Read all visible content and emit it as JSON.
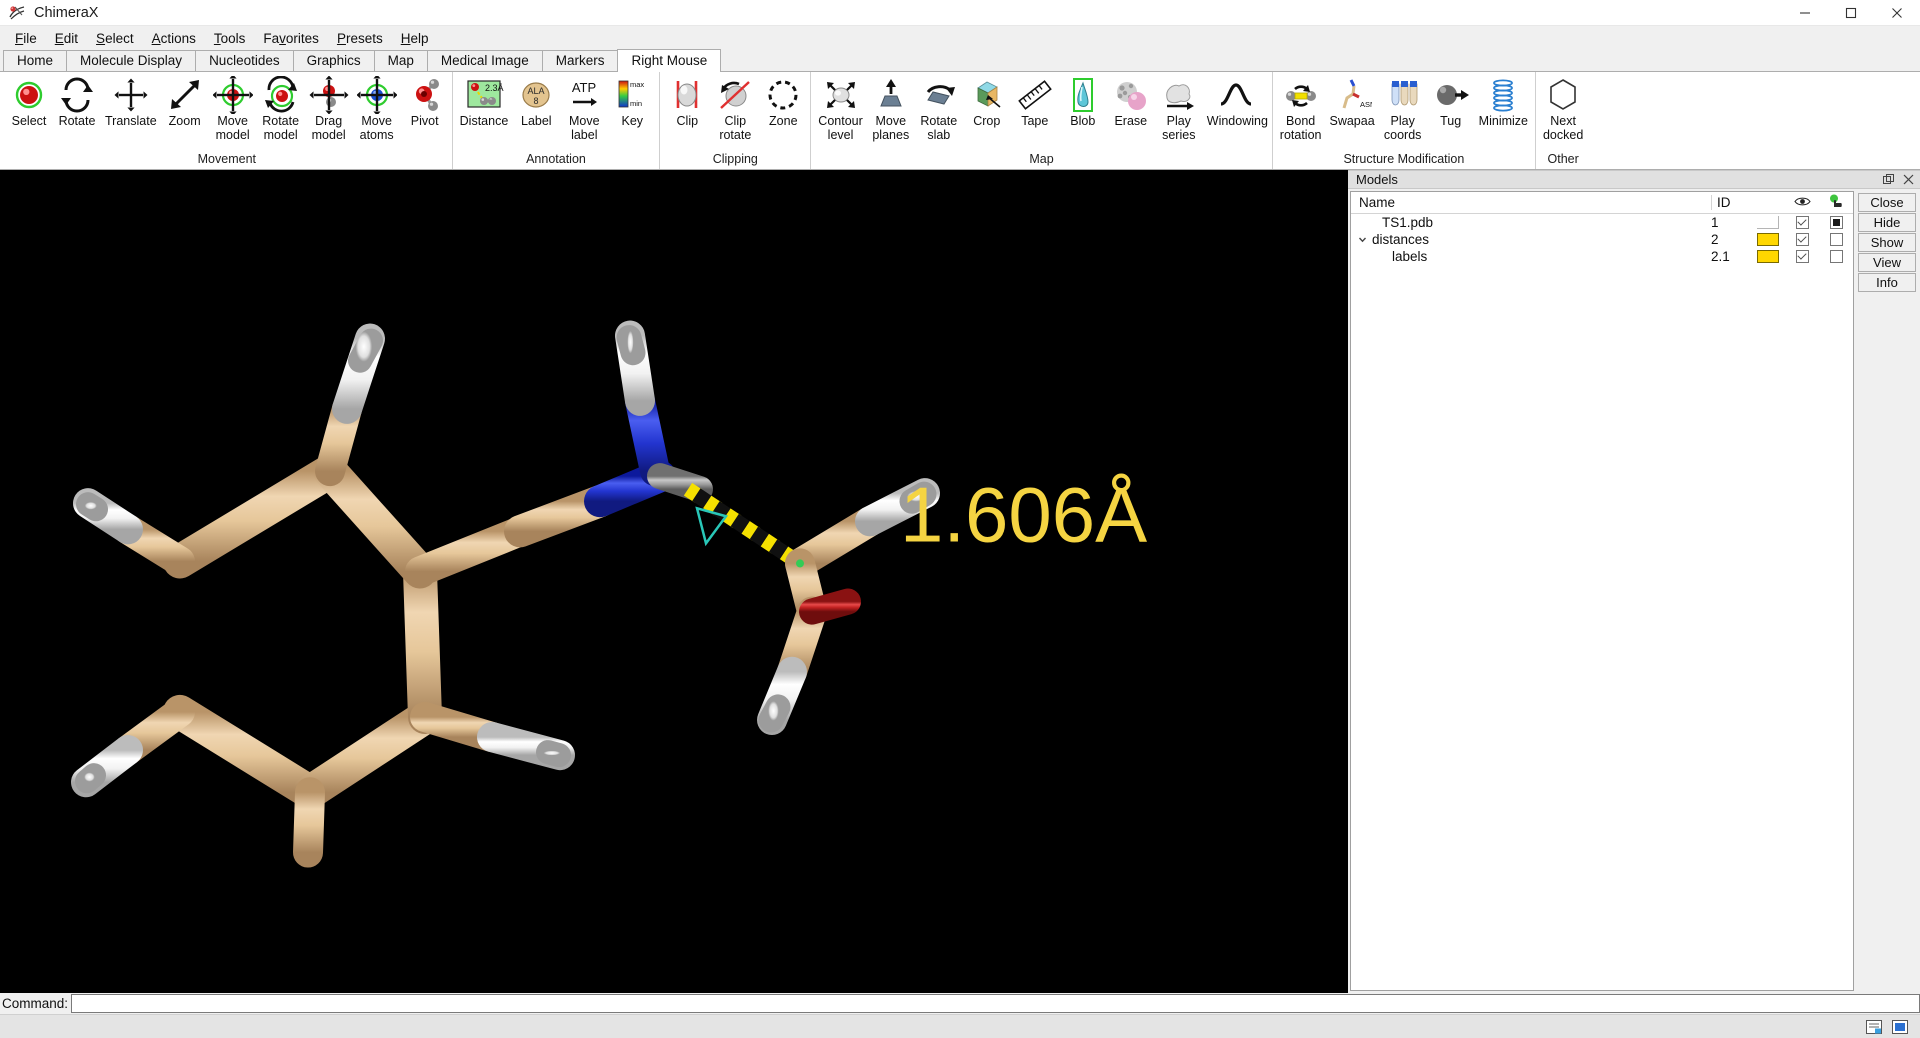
{
  "window": {
    "title": "ChimeraX",
    "app_icon": "chimerax-logo-icon",
    "minimize": "minimize-icon",
    "maximize": "maximize-icon",
    "close": "close-icon"
  },
  "menubar": {
    "items": [
      {
        "label": "File",
        "accel": "F"
      },
      {
        "label": "Edit",
        "accel": "E"
      },
      {
        "label": "Select",
        "accel": "S"
      },
      {
        "label": "Actions",
        "accel": "A"
      },
      {
        "label": "Tools",
        "accel": "T"
      },
      {
        "label": "Favorites",
        "accel": "v"
      },
      {
        "label": "Presets",
        "accel": "P"
      },
      {
        "label": "Help",
        "accel": "H"
      }
    ]
  },
  "tabs": {
    "active": "Right Mouse",
    "items": [
      "Home",
      "Molecule Display",
      "Nucleotides",
      "Graphics",
      "Map",
      "Medical Image",
      "Markers",
      "Right Mouse"
    ]
  },
  "ribbon": {
    "groups": [
      {
        "caption": "Movement",
        "buttons": [
          {
            "label": "Select",
            "icon": "red-sphere-select-icon"
          },
          {
            "label": "Rotate",
            "icon": "circular-arrows-rotate-icon"
          },
          {
            "label": "Translate",
            "icon": "four-way-arrows-translate-icon"
          },
          {
            "label": "Zoom",
            "icon": "diagonal-arrows-zoom-icon"
          },
          {
            "label": "Move\nmodel",
            "icon": "move-model-icon"
          },
          {
            "label": "Rotate\nmodel",
            "icon": "rotate-model-icon"
          },
          {
            "label": "Drag\nmodel",
            "icon": "drag-model-icon"
          },
          {
            "label": "Move\natoms",
            "icon": "move-atoms-icon"
          },
          {
            "label": "Pivot",
            "icon": "pivot-icon"
          }
        ]
      },
      {
        "caption": "Annotation",
        "buttons": [
          {
            "label": "Distance",
            "icon": "distance-measure-icon",
            "badge": "2.3Å"
          },
          {
            "label": "Label",
            "icon": "residue-label-icon",
            "badge": "ALA"
          },
          {
            "label": "Move\nlabel",
            "icon": "move-label-icon",
            "badge": "ATP"
          },
          {
            "label": "Key",
            "icon": "color-key-icon",
            "badge_max": "max",
            "badge_min": "min"
          }
        ]
      },
      {
        "caption": "Clipping",
        "buttons": [
          {
            "label": "Clip",
            "icon": "clip-planes-icon"
          },
          {
            "label": "Clip\nrotate",
            "icon": "clip-rotate-icon"
          },
          {
            "label": "Zone",
            "icon": "zone-dashed-circle-icon"
          }
        ]
      },
      {
        "caption": "Map",
        "buttons": [
          {
            "label": "Contour\nlevel",
            "icon": "contour-level-icon"
          },
          {
            "label": "Move\nplanes",
            "icon": "move-planes-icon"
          },
          {
            "label": "Rotate\nslab",
            "icon": "rotate-slab-icon"
          },
          {
            "label": "Crop",
            "icon": "crop-cube-icon"
          },
          {
            "label": "Tape",
            "icon": "tape-measure-icon"
          },
          {
            "label": "Blob",
            "icon": "blob-icon"
          },
          {
            "label": "Erase",
            "icon": "erase-icon"
          },
          {
            "label": "Play\nseries",
            "icon": "play-series-icon"
          },
          {
            "label": "Windowing",
            "icon": "windowing-curve-icon"
          }
        ]
      },
      {
        "caption": "Structure Modification",
        "buttons": [
          {
            "label": "Bond\nrotation",
            "icon": "bond-rotation-icon"
          },
          {
            "label": "Swapaa",
            "icon": "swap-amino-acid-icon",
            "badge": "ASN"
          },
          {
            "label": "Play\ncoords",
            "icon": "play-coords-icon"
          },
          {
            "label": "Tug",
            "icon": "tug-icon"
          },
          {
            "label": "Minimize",
            "icon": "minimize-spring-icon"
          }
        ]
      },
      {
        "caption": "Other",
        "buttons": [
          {
            "label": "Next\ndocked",
            "icon": "next-docked-hexagon-icon"
          }
        ]
      }
    ]
  },
  "graphics": {
    "background": "#000000",
    "distance_label": "1.606Å",
    "distance_label_color": "#f5d442",
    "carbon_color": "#e8c79a",
    "hydrogen_color": "#ffffff",
    "nitrogen_color": "#2036d8",
    "oxygen_color": "#d02020",
    "pseudobond_colors": [
      "#f5e000",
      "#1a1a1a"
    ]
  },
  "models_panel": {
    "title": "Models",
    "float_icon": "undock-icon",
    "close_icon": "close-panel-icon",
    "columns": {
      "name": "Name",
      "id": "ID",
      "color": "",
      "shown": "eye-icon",
      "select": "select-hand-icon"
    },
    "rows": [
      {
        "name": "TS1.pdb",
        "id": "1",
        "indent": 1,
        "twisty": "",
        "color": "#ffffff",
        "color_visible": false,
        "shown": true,
        "selected": "filled"
      },
      {
        "name": "distances",
        "id": "2",
        "indent": 0,
        "twisty": "chevron-down-icon",
        "color": "#ffd700",
        "color_visible": true,
        "shown": true,
        "selected": "empty"
      },
      {
        "name": "labels",
        "id": "2.1",
        "indent": 2,
        "twisty": "",
        "color": "#ffd700",
        "color_visible": true,
        "shown": true,
        "selected": "empty"
      }
    ],
    "buttons": [
      "Close",
      "Hide",
      "Show",
      "View",
      "Info"
    ]
  },
  "command": {
    "label": "Command:",
    "value": "",
    "placeholder": ""
  },
  "statusbar": {
    "text": "",
    "icons": [
      "notes-icon",
      "blue-square-icon"
    ]
  }
}
